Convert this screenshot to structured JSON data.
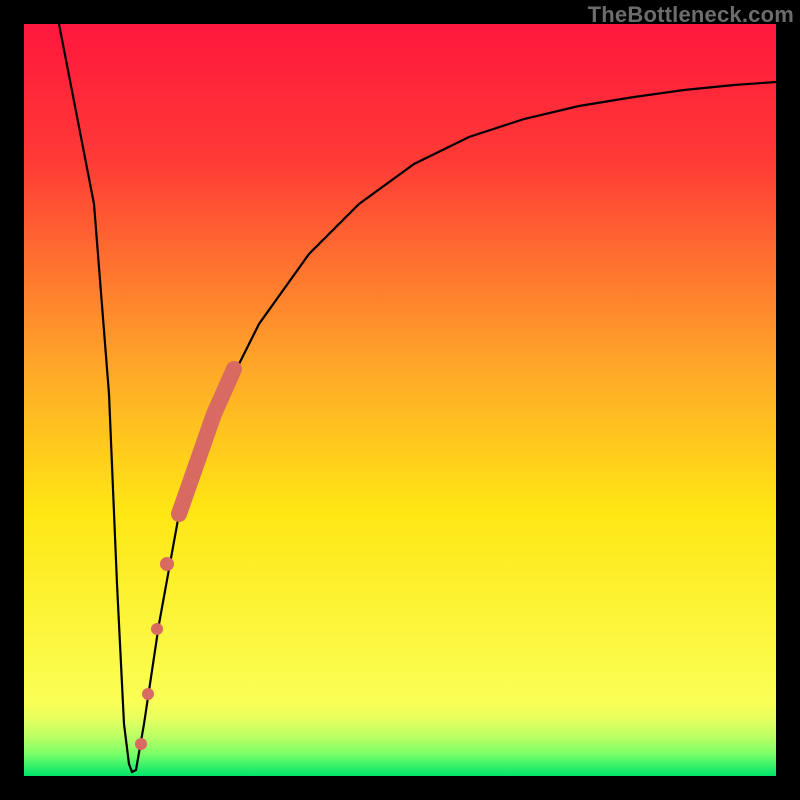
{
  "brand": "TheBottleneck.com",
  "chart_data": {
    "type": "line",
    "title": "",
    "xlabel": "",
    "ylabel": "",
    "xlim": [
      0,
      100
    ],
    "ylim": [
      0,
      100
    ],
    "grid": false,
    "background": {
      "type": "vertical-gradient",
      "stops": [
        {
          "y": 100,
          "color": "#ff173d"
        },
        {
          "y": 55,
          "color": "#ffa529"
        },
        {
          "y": 35,
          "color": "#ffe714"
        },
        {
          "y": 8,
          "color": "#faff55"
        },
        {
          "y": 4,
          "color": "#9bff6a"
        },
        {
          "y": 0,
          "color": "#00e56a"
        }
      ]
    },
    "series": [
      {
        "name": "bottleneck-curve",
        "color": "#000000",
        "x": [
          0,
          4,
          8,
          10,
          11,
          12,
          13,
          14,
          15,
          17,
          20,
          25,
          30,
          35,
          40,
          45,
          50,
          55,
          60,
          65,
          70,
          75,
          80,
          85,
          90,
          95,
          100
        ],
        "values": [
          100,
          75,
          50,
          25,
          10,
          1,
          2,
          10,
          20,
          30,
          42,
          55,
          65,
          72,
          77,
          81,
          84,
          86,
          88,
          89.5,
          90.5,
          91.3,
          92,
          92.5,
          93,
          93.3,
          93.5
        ]
      }
    ],
    "markers": [
      {
        "name": "highlighted-points",
        "color": "#d86a62",
        "x_range": [
          14,
          29
        ],
        "y_range": [
          3,
          41
        ],
        "shape": "round",
        "approx_count": 25
      }
    ]
  }
}
